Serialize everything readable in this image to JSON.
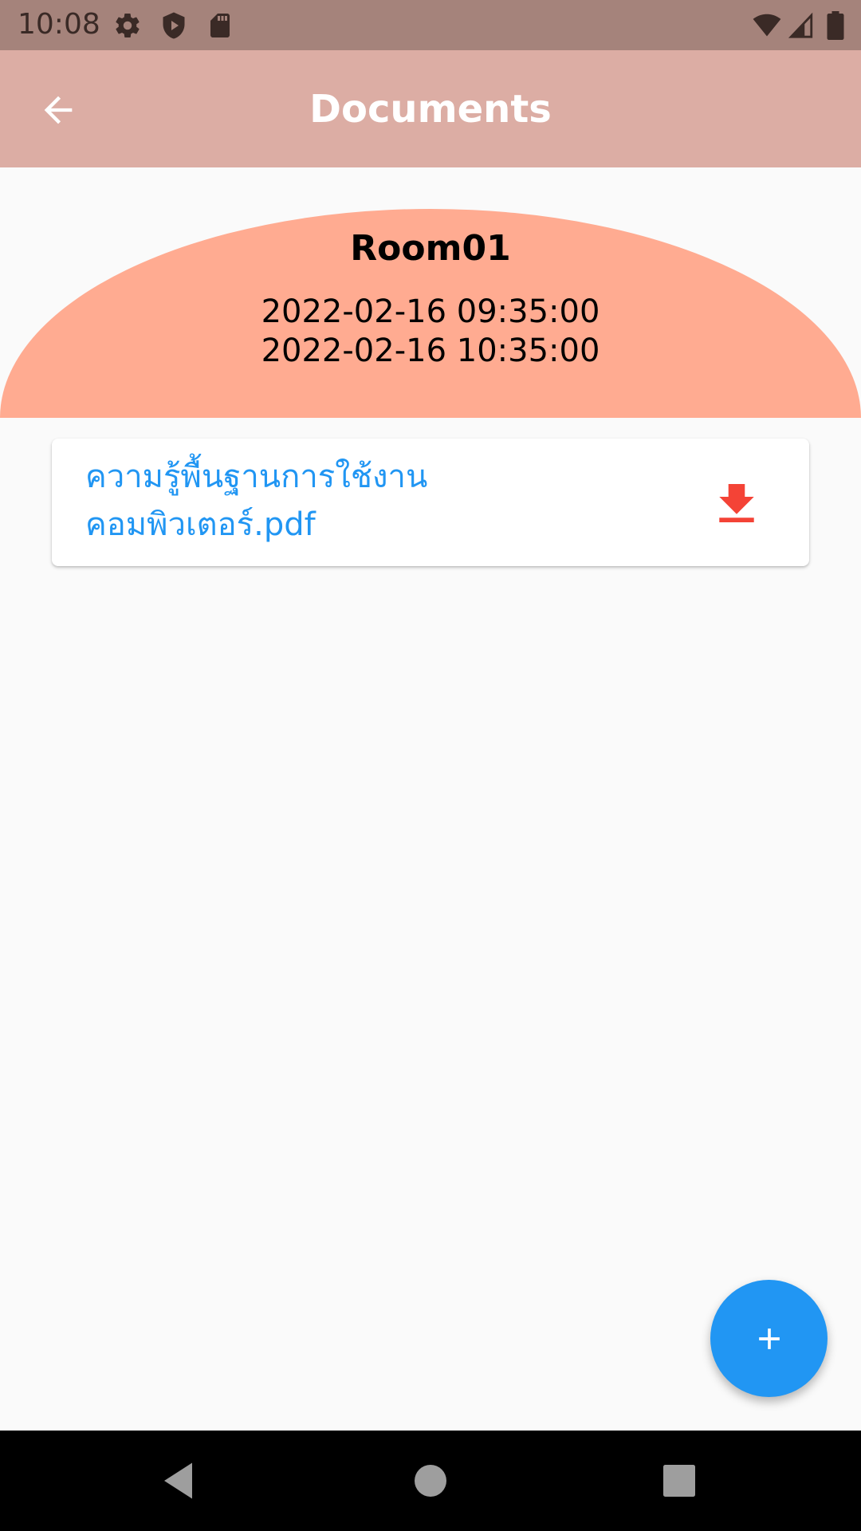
{
  "status_bar": {
    "time": "10:08",
    "left_icons": [
      "gear-icon",
      "shield-play-icon",
      "sd-card-icon"
    ],
    "right_icons": [
      "wifi-icon",
      "cell-signal-icon",
      "battery-icon"
    ]
  },
  "app_bar": {
    "title": "Documents",
    "back_icon": "arrow-back-icon"
  },
  "room": {
    "name": "Room01",
    "start_time": "2022-02-16 09:35:00",
    "end_time": "2022-02-16 10:35:00"
  },
  "documents": [
    {
      "name": "ความรู้พื้นฐานการใช้งานคอมพิวเตอร์.pdf",
      "action_icon": "download-icon"
    }
  ],
  "fab": {
    "icon": "plus-icon"
  },
  "nav_bar": {
    "icons": [
      "back-triangle-icon",
      "home-circle-icon",
      "recents-square-icon"
    ]
  },
  "colors": {
    "status_bar": "#a5837b",
    "app_bar": "#dcada4",
    "header_arc": "#ffab91",
    "link_blue": "#2196f3",
    "download_red": "#f44336",
    "fab": "#2196f3"
  }
}
